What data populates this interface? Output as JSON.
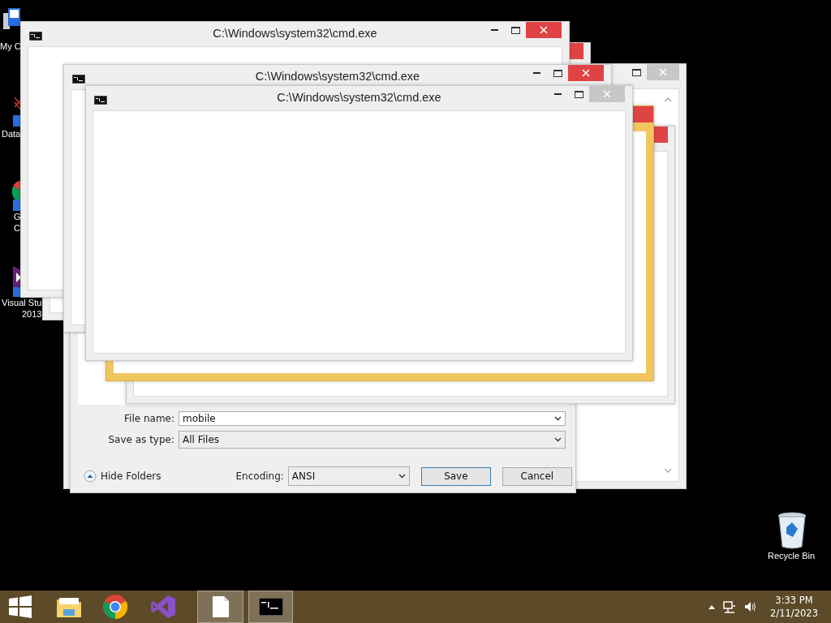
{
  "desktop_icons": [
    {
      "kind": "computer",
      "label": [
        "My C"
      ]
    },
    {
      "kind": "database",
      "label": [
        "Data"
      ]
    },
    {
      "kind": "browser",
      "label": [
        "G",
        "C"
      ]
    },
    {
      "kind": "ide",
      "label": [
        "Visual Stu",
        "2013"
      ]
    },
    {
      "kind": "recycle",
      "label": [
        "Recycle Bin"
      ]
    }
  ],
  "windows": [
    {
      "kind": "explorer",
      "close_active": false
    },
    {
      "kind": "save_dialog",
      "file_name_label": "File name:",
      "file_name": "mobile",
      "type_label": "Save as type:",
      "type_value": "All Files",
      "hide_folders": "Hide Folders",
      "encoding_label": "Encoding:",
      "encoding": "ANSI",
      "buttons": [
        "Save",
        "Cancel"
      ]
    },
    {
      "kind": "plain",
      "close_active": true
    },
    {
      "kind": "accent",
      "close_active": true
    },
    {
      "kind": "plain",
      "close_active": true
    },
    {
      "kind": "cmd",
      "title": "C:\\Windows\\system32\\cmd.exe",
      "close_active": true
    },
    {
      "kind": "cmd",
      "title": "C:\\Windows\\system32\\cmd.exe",
      "close_active": true
    },
    {
      "kind": "cmd",
      "title": "C:\\Windows\\system32\\cmd.exe",
      "close_active": false
    }
  ],
  "taskbar": {
    "items": [
      {
        "kind": "start",
        "selected": false
      },
      {
        "kind": "explorer",
        "selected": false
      },
      {
        "kind": "chrome",
        "selected": false
      },
      {
        "kind": "vs",
        "selected": false
      },
      {
        "kind": "notepad",
        "selected": true
      },
      {
        "kind": "cmd",
        "selected": true
      }
    ],
    "time": "3:33 PM",
    "date": "2/11/2023"
  }
}
